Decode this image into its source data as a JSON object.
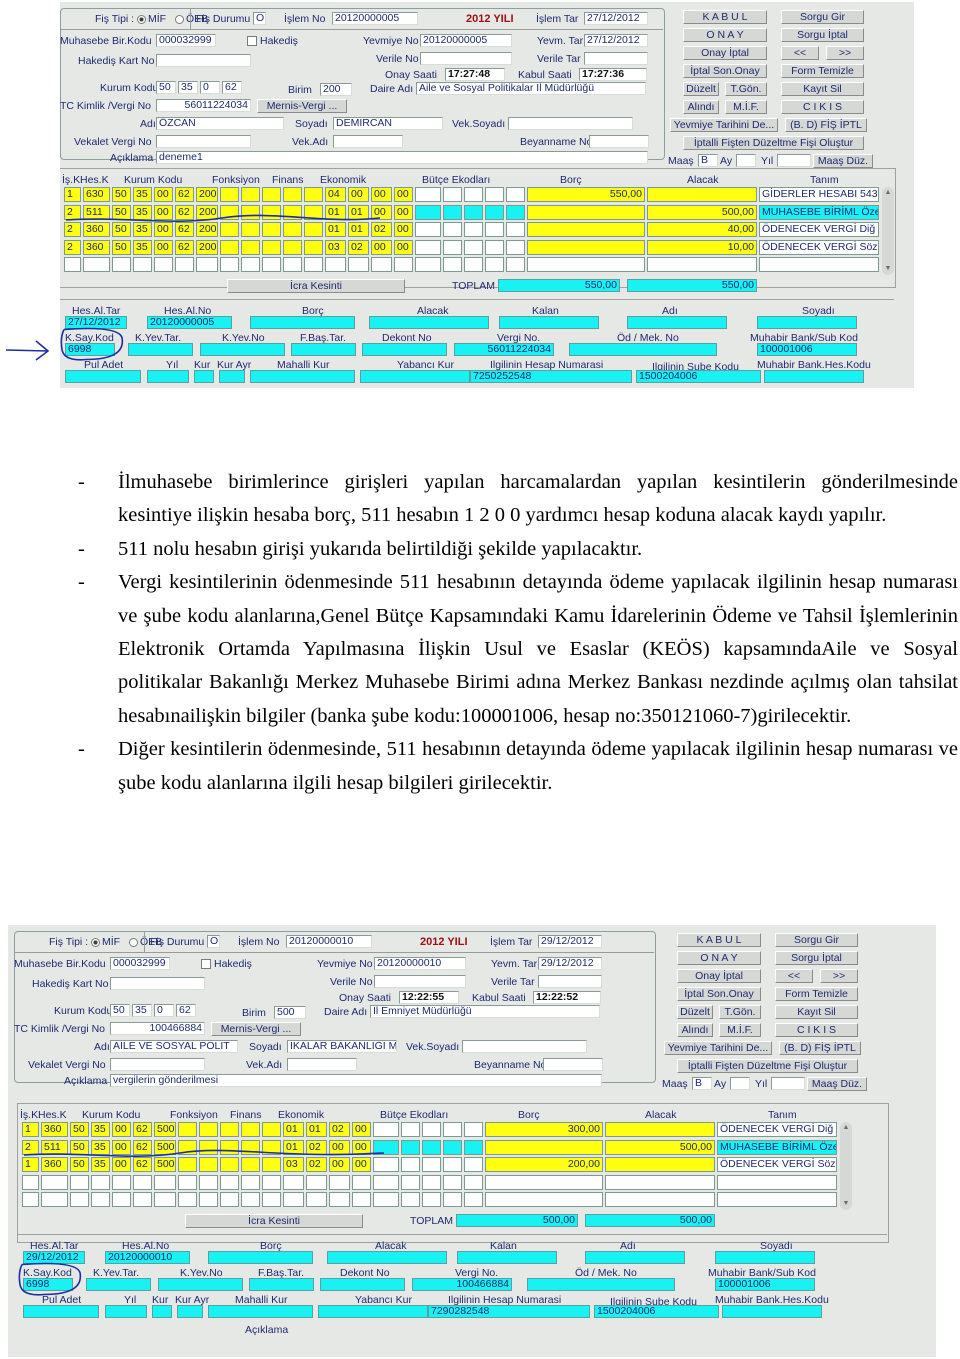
{
  "screenshot1": {
    "header": {
      "fis_tipi_label": "Fiş Tipi :",
      "radio_mif": "MİF",
      "radio_oeb": "ÖEB",
      "fis_durumu_label": "Fiş Durumu",
      "fis_durumu_value": "O",
      "islem_no_label": "İşlem No",
      "islem_no_value": "20120000005",
      "year_label": "2012 YILI",
      "islem_tar_label": "İşlem Tar",
      "islem_tar_value": "27/12/2012"
    },
    "form": {
      "muhasebe_bir_kodu_label": "Muhasebe Bir.Kodu",
      "muhasebe_bir_kodu_value": "000032999",
      "hakedis_label": "Hakediş",
      "hakedis_kart_no_label": "Hakediş Kart No",
      "hakedis_kart_no_value": "",
      "yevmiye_no_label": "Yevmiye No",
      "yevmiye_no_value": "20120000005",
      "yevm_tar_label": "Yevm. Tar",
      "yevm_tar_value": "27/12/2012",
      "verile_no_label": "Verile No",
      "verile_no_value": "",
      "verile_tar_label": "Verile Tar",
      "verile_tar_value": "",
      "onay_saati_label": "Onay Saati",
      "onay_saati_value": "17:27:48",
      "kabul_saati_label": "Kabul Saati",
      "kabul_saati_value": "17:27:36",
      "kurum_kodu_label": "Kurum Kodu",
      "kurum_kodu_values": [
        "50",
        "35",
        "0",
        "62"
      ],
      "birim_label": "Birim",
      "birim_value": "200",
      "daire_adi_label": "Daire Adı",
      "daire_adi_value": "Aile ve Sosyal Politikalar İl Müdürlüğü",
      "tc_kimlik_label": "TC Kimlik /Vergi No",
      "tc_kimlik_value": "56011224034",
      "mernis_button": "Mernis-Vergi ...",
      "adi_label": "Adı",
      "adi_value": "ÖZCAN",
      "soyadi_label": "Soyadı",
      "soyadi_value": "DEMİRCAN",
      "vek_soyadi_label": "Vek.Soyadı",
      "vek_soyadi_value": "",
      "vekalet_vergi_no_label": "Vekalet Vergi No",
      "vekalet_vergi_no_value": "",
      "vek_adi_label": "Vek.Adı",
      "vek_adi_value": "",
      "beyanname_no_label": "Beyanname No",
      "beyanname_no_value": "",
      "aciklama_label": "Açıklama",
      "aciklama_value": "deneme1"
    },
    "buttons": {
      "kabul": "K A B U L",
      "sorgu_gir": "Sorgu Gir",
      "onay": "O N A Y",
      "sorgu_iptal": "Sorgu İptal",
      "onay_iptal": "Onay İptal",
      "prev": "<<",
      "next": ">>",
      "iptal_son_onay": "İptal Son.Onay",
      "form_temizle": "Form Temizle",
      "duzelt": "Düzelt",
      "t_gon": "T.Gön.",
      "kayit_sil": "Kayıt Sil",
      "alindi": "Alındı",
      "mif": "M.İ.F.",
      "cikis": "C I K I S",
      "yevmiye_tarihini": "Yevmiye Tarihini De...",
      "bd_fis_iptal": "(B. D) FİŞ İPTL",
      "iptalli_fisten": "İptalli Fişten Düzeltme Fişi Oluştur",
      "maas_label": "Maaş",
      "maas_value": "B",
      "ay_label": "Ay",
      "ay_value": "",
      "yil_label": "Yıl",
      "yil_value": "",
      "maas_duz": "Maaş Düz."
    },
    "grid": {
      "headers": {
        "is_k": "İş.K.",
        "hes_k": "Hes.K",
        "kurum_kodu": "Kurum Kodu",
        "fonksiyon": "Fonksiyon",
        "finans": "Finans",
        "ekonomik": "Ekonomik",
        "butce_ekodlari": "Bütçe Ekodları",
        "borc": "Borç",
        "alacak": "Alacak",
        "tanim": "Tanım"
      },
      "rows": [
        {
          "is_k": "1",
          "hes_k": "630",
          "kurum": [
            "50",
            "35",
            "00",
            "62",
            "200"
          ],
          "fonk": [
            "",
            "",
            "",
            "",
            ""
          ],
          "eko": [
            "04",
            "00",
            "00",
            "00"
          ],
          "borc": "550,00",
          "alacak": "",
          "tanim": "GİDERLER HESABI 543",
          "highlight": false
        },
        {
          "is_k": "2",
          "hes_k": "511",
          "kurum": [
            "50",
            "35",
            "00",
            "62",
            "200"
          ],
          "fonk": [
            "",
            "",
            "",
            "",
            ""
          ],
          "eko": [
            "01",
            "01",
            "00",
            "00"
          ],
          "borc": "",
          "alacak": "500,00",
          "tanim": "MUHASEBE BİRİML Öze",
          "highlight": true
        },
        {
          "is_k": "2",
          "hes_k": "360",
          "kurum": [
            "50",
            "35",
            "00",
            "62",
            "200"
          ],
          "fonk": [
            "",
            "",
            "",
            "",
            ""
          ],
          "eko": [
            "01",
            "01",
            "02",
            "00"
          ],
          "borc": "",
          "alacak": "40,00",
          "tanim": "ÖDENECEK VERGİ  Diğ",
          "highlight": false
        },
        {
          "is_k": "2",
          "hes_k": "360",
          "kurum": [
            "50",
            "35",
            "00",
            "62",
            "200"
          ],
          "fonk": [
            "",
            "",
            "",
            "",
            ""
          ],
          "eko": [
            "03",
            "02",
            "00",
            "00"
          ],
          "borc": "",
          "alacak": "10,00",
          "tanim": "ÖDENECEK VERGİ  Söz",
          "highlight": false
        }
      ],
      "icra_kesinti": "İcra Kesinti",
      "toplam_label": "TOPLAM",
      "toplam_borc": "550,00",
      "toplam_alacak": "550,00"
    },
    "detail": {
      "hes_al_tar_label": "Hes.Al.Tar",
      "hes_al_tar_value": "27/12/2012",
      "hes_al_no_label": "Hes.Al.No",
      "hes_al_no_value": "20120000005",
      "borc_label": "Borç",
      "borc_value": "",
      "alacak_label": "Alacak",
      "alacak_value": "",
      "kalan_label": "Kalan",
      "kalan_value": "",
      "adi_label": "Adı",
      "adi_value": "",
      "soyadi_label": "Soyadı",
      "soyadi_value": "",
      "k_say_kod_label": "K.Say.Kod",
      "k_say_kod_value": "6998",
      "k_yev_tar_label": "K.Yev.Tar.",
      "k_yev_tar_value": "",
      "k_yev_no_label": "K.Yev.No",
      "k_yev_no_value": "",
      "f_bas_tar_label": "F.Baş.Tar.",
      "f_bas_tar_value": "",
      "dekont_no_label": "Dekont No",
      "dekont_no_value": "",
      "vergi_no_label": "Vergi No.",
      "vergi_no_value": "56011224034",
      "od_mek_no_label": "Öd / Mek. No",
      "od_mek_no_value": "",
      "muhabir_bank_sub_label": "Muhabir Bank/Sub Kod",
      "muhabir_bank_sub_value": "100001006",
      "pul_adet_label": "Pul Adet",
      "yil_label": "Yıl",
      "kur_label": "Kur",
      "kur_ayr_label": "Kur Ayr",
      "mahalli_kur_label": "Mahalli Kur",
      "yabanci_kur_label": "Yabancı  Kur",
      "ilgilinin_hesap_label": "Ilgilinin Hesap Numarasi",
      "ilgilinin_hesap_value": "7250252548",
      "ilgilinin_sube_label": "Ilgilinin Sube Kodu",
      "ilgilinin_sube_value": "1500204006",
      "muhabir_bank_hes_label": "Muhabir Bank.Hes.Kodu",
      "muhabir_bank_hes_value": ""
    }
  },
  "document": {
    "bullets": [
      "İlmuhasebe birimlerince girişleri yapılan harcamalardan yapılan kesintilerin gönderilmesinde kesintiye ilişkin hesaba borç, 511 hesabın 1  2  0  0 yardımcı hesap koduna alacak kaydı yapılır.",
      "511 nolu hesabın girişi yukarıda belirtildiği şekilde yapılacaktır.",
      "Vergi kesintilerinin ödenmesinde 511 hesabının detayında ödeme yapılacak ilgilinin hesap numarası ve şube kodu alanlarına,Genel Bütçe Kapsamındaki Kamu İdarelerinin Ödeme ve Tahsil İşlemlerinin Elektronik Ortamda Yapılmasına İlişkin Usul ve Esaslar (KEÖS) kapsamındaAile ve Sosyal politikalar Bakanlığı Merkez Muhasebe Birimi adına Merkez Bankası nezdinde açılmış olan tahsilat hesabınailişkin bilgiler (banka şube kodu:100001006, hesap no:350121060-7)girilecektir.",
      "Diğer kesintilerin ödenmesinde, 511 hesabının detayında ödeme yapılacak ilgilinin hesap numarası ve şube kodu alanlarına ilgili hesap bilgileri girilecektir."
    ],
    "dash": "-"
  },
  "screenshot2": {
    "header": {
      "fis_tipi_label": "Fiş Tipi :",
      "radio_mif": "MİF",
      "radio_oeb": "ÖEB",
      "fis_durumu_label": "Fiş Durumu",
      "fis_durumu_value": "O",
      "islem_no_label": "İşlem No",
      "islem_no_value": "20120000010",
      "year_label": "2012 YILI",
      "islem_tar_label": "İşlem Tar",
      "islem_tar_value": "29/12/2012"
    },
    "form": {
      "muhasebe_bir_kodu_label": "Muhasebe Bir.Kodu",
      "muhasebe_bir_kodu_value": "000032999",
      "hakedis_label": "Hakediş",
      "hakedis_kart_no_label": "Hakediş Kart No",
      "hakedis_kart_no_value": "",
      "yevmiye_no_label": "Yevmiye No",
      "yevmiye_no_value": "20120000010",
      "yevm_tar_label": "Yevm. Tar",
      "yevm_tar_value": "29/12/2012",
      "verile_no_label": "Verile No",
      "verile_no_value": "",
      "verile_tar_label": "Verile Tar",
      "verile_tar_value": "",
      "onay_saati_label": "Onay Saati",
      "onay_saati_value": "12:22:55",
      "kabul_saati_label": "Kabul Saati",
      "kabul_saati_value": "12:22:52",
      "kurum_kodu_label": "Kurum Kodu",
      "kurum_kodu_values": [
        "50",
        "35",
        "0",
        "62"
      ],
      "birim_label": "Birim",
      "birim_value": "500",
      "daire_adi_label": "Daire Adı",
      "daire_adi_value": "İl Emniyet Müdürlüğü",
      "tc_kimlik_label": "TC Kimlik /Vergi No",
      "tc_kimlik_value": "100466884",
      "mernis_button": "Mernis-Vergi ...",
      "adi_label": "Adı",
      "adi_value": "AİLE VE SOSYAL POLİT",
      "soyadi_label": "Soyadı",
      "soyadi_value": "İKALAR BAKANLIĞI MER",
      "vek_soyadi_label": "Vek.Soyadı",
      "vek_soyadi_value": "",
      "vekalet_vergi_no_label": "Vekalet Vergi No",
      "vekalet_vergi_no_value": "",
      "vek_adi_label": "Vek.Adı",
      "vek_adi_value": "",
      "beyanname_no_label": "Beyanname No",
      "beyanname_no_value": "",
      "aciklama_label": "Açıklama",
      "aciklama_value": "vergilerin gönderilmesi"
    },
    "buttons": {
      "kabul": "K A B U L",
      "sorgu_gir": "Sorgu Gir",
      "onay": "O N A Y",
      "sorgu_iptal": "Sorgu İptal",
      "onay_iptal": "Onay İptal",
      "prev": "<<",
      "next": ">>",
      "iptal_son_onay": "İptal Son.Onay",
      "form_temizle": "Form Temizle",
      "duzelt": "Düzelt",
      "t_gon": "T.Gön.",
      "kayit_sil": "Kayıt Sil",
      "alindi": "Alındı",
      "mif": "M.İ.F.",
      "cikis": "C I K I S",
      "yevmiye_tarihini": "Yevmiye Tarihini De...",
      "bd_fis_iptal": "(B. D) FİŞ İPTL",
      "iptalli_fisten": "İptalli Fişten Düzeltme Fişi Oluştur",
      "maas_label": "Maaş",
      "maas_value": "B",
      "ay_label": "Ay",
      "ay_value": "",
      "yil_label": "Yıl",
      "yil_value": "",
      "maas_duz": "Maaş Düz."
    },
    "grid": {
      "headers": {
        "is_k": "İş.K.",
        "hes_k": "Hes.K",
        "kurum_kodu": "Kurum Kodu",
        "fonksiyon": "Fonksiyon",
        "finans": "Finans",
        "ekonomik": "Ekonomik",
        "butce_ekodlari": "Bütçe Ekodları",
        "borc": "Borç",
        "alacak": "Alacak",
        "tanim": "Tanım"
      },
      "rows": [
        {
          "is_k": "1",
          "hes_k": "360",
          "kurum": [
            "50",
            "35",
            "00",
            "62",
            "500"
          ],
          "fonk": [
            "",
            "",
            "",
            "",
            ""
          ],
          "eko": [
            "01",
            "01",
            "02",
            "00"
          ],
          "borc": "300,00",
          "alacak": "",
          "tanim": "ÖDENECEK VERGİ  Diğ",
          "highlight": false
        },
        {
          "is_k": "2",
          "hes_k": "511",
          "kurum": [
            "50",
            "35",
            "00",
            "62",
            "500"
          ],
          "fonk": [
            "",
            "",
            "",
            "",
            ""
          ],
          "eko": [
            "01",
            "02",
            "00",
            "00"
          ],
          "borc": "",
          "alacak": "500,00",
          "tanim": "MUHASEBE BİRİML Öze",
          "highlight": true
        },
        {
          "is_k": "1",
          "hes_k": "360",
          "kurum": [
            "50",
            "35",
            "00",
            "62",
            "500"
          ],
          "fonk": [
            "",
            "",
            "",
            "",
            ""
          ],
          "eko": [
            "03",
            "02",
            "00",
            "00"
          ],
          "borc": "200,00",
          "alacak": "",
          "tanim": "ÖDENECEK VERGİ  Söz",
          "highlight": false
        }
      ],
      "icra_kesinti": "İcra Kesinti",
      "toplam_label": "TOPLAM",
      "toplam_borc": "500,00",
      "toplam_alacak": "500,00"
    },
    "detail": {
      "hes_al_tar_label": "Hes.Al.Tar",
      "hes_al_tar_value": "29/12/2012",
      "hes_al_no_label": "Hes.Al.No",
      "hes_al_no_value": "20120000010",
      "borc_label": "Borç",
      "borc_value": "",
      "alacak_label": "Alacak",
      "alacak_value": "",
      "kalan_label": "Kalan",
      "kalan_value": "",
      "adi_label": "Adı",
      "adi_value": "",
      "soyadi_label": "Soyadı",
      "soyadi_value": "",
      "k_say_kod_label": "K.Say.Kod",
      "k_say_kod_value": "6998",
      "k_yev_tar_label": "K.Yev.Tar.",
      "k_yev_tar_value": "",
      "k_yev_no_label": "K.Yev.No",
      "k_yev_no_value": "",
      "f_bas_tar_label": "F.Baş.Tar.",
      "f_bas_tar_value": "",
      "dekont_no_label": "Dekont No",
      "dekont_no_value": "",
      "vergi_no_label": "Vergi No.",
      "vergi_no_value": "100466884",
      "od_mek_no_label": "Öd / Mek. No",
      "od_mek_no_value": "",
      "muhabir_bank_sub_label": "Muhabir Bank/Sub Kod",
      "muhabir_bank_sub_value": "100001006",
      "pul_adet_label": "Pul Adet",
      "yil_label": "Yıl",
      "kur_label": "Kur",
      "kur_ayr_label": "Kur Ayr",
      "mahalli_kur_label": "Mahalli Kur",
      "yabanci_kur_label": "Yabancı  Kur",
      "ilgilinin_hesap_label": "Ilgilinin Hesap Numarasi",
      "ilgilinin_hesap_value": "7290282548",
      "ilgilinin_sube_label": "Ilgilinin Sube Kodu",
      "ilgilinin_sube_value": "1500204006",
      "muhabir_bank_hes_label": "Muhabir Bank.Hes.Kodu",
      "muhabir_bank_hes_value": "",
      "aciklama_label": "Açıklama"
    }
  },
  "colors": {
    "field_yellow": "#ffff10",
    "field_cyan": "#19f2f2",
    "window_bg": "#e6e8e6",
    "label_text": "#1e2a70",
    "year_text": "#a01010",
    "annotation_ink": "#1c2ea0"
  }
}
